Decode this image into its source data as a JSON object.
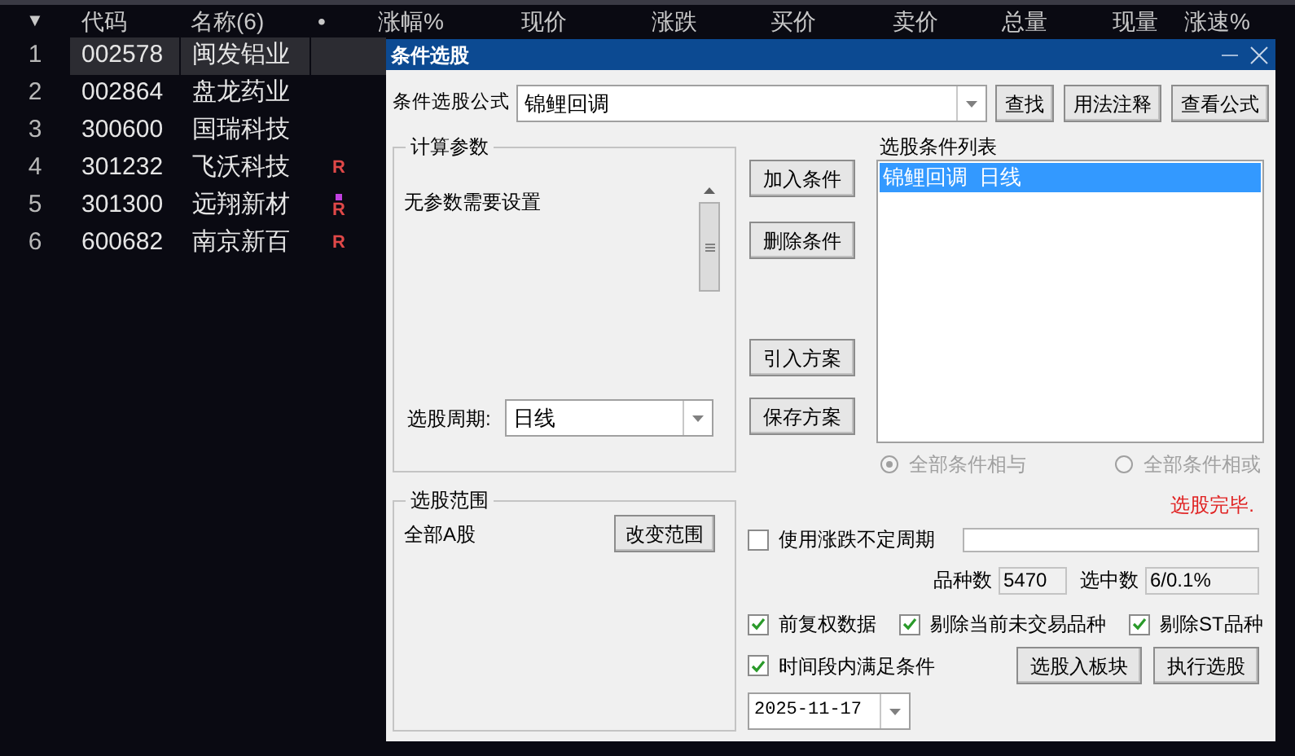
{
  "table": {
    "columns": [
      "▼",
      "代码",
      "名称(6)",
      "•",
      "涨幅%",
      "现价",
      "涨跌",
      "买价",
      "卖价",
      "总量",
      "现量",
      "涨速%"
    ],
    "rows": [
      {
        "index": "1",
        "code": "002578",
        "name": "闽发铝业",
        "selected": true,
        "marked": false
      },
      {
        "index": "2",
        "code": "002864",
        "name": "盘龙药业",
        "selected": false,
        "marked": false
      },
      {
        "index": "3",
        "code": "300600",
        "name": "国瑞科技",
        "selected": false,
        "marked": false
      },
      {
        "index": "4",
        "code": "301232",
        "name": "飞沃科技",
        "flag": "R",
        "selected": false,
        "marked": false
      },
      {
        "index": "5",
        "code": "301300",
        "name": "远翔新材",
        "flag": "R",
        "selected": false,
        "marked": true
      },
      {
        "index": "6",
        "code": "600682",
        "name": "南京新百",
        "flag": "R",
        "selected": false,
        "marked": false
      }
    ]
  },
  "dialog": {
    "title": "条件选股",
    "formula": {
      "label": "条件选股公式",
      "value": "锦鲤回调"
    },
    "top_buttons": [
      "查找",
      "用法注释",
      "查看公式"
    ],
    "params_group": {
      "title": "计算参数",
      "message": "无参数需要设置",
      "period_label": "选股周期:",
      "period_value": "日线"
    },
    "condition_buttons": [
      "加入条件",
      "删除条件"
    ],
    "plan_buttons": [
      "引入方案",
      "保存方案"
    ],
    "condition_list": {
      "label": "选股条件列表",
      "items": [
        {
          "text": "锦鲤回调  日线",
          "selected": true
        }
      ]
    },
    "logic_options": [
      {
        "label": "全部条件相与",
        "selected": true,
        "disabled": true
      },
      {
        "label": "全部条件相或",
        "selected": false,
        "disabled": true
      }
    ],
    "status": "选股完毕.",
    "range_group": {
      "title": "选股范围",
      "value": "全部A股",
      "button": "改变范围"
    },
    "variable_period": {
      "label": "使用涨跌不定周期",
      "checked": false
    },
    "counts": [
      {
        "label": "品种数",
        "value": "5470"
      },
      {
        "label": "选中数",
        "value": "6/0.1%"
      }
    ],
    "options": [
      {
        "label": "前复权数据",
        "checked": true
      },
      {
        "label": "剔除当前未交易品种",
        "checked": true
      },
      {
        "label": "剔除ST品种",
        "checked": true
      }
    ],
    "period_option": {
      "label": "时间段内满足条件",
      "checked": true
    },
    "action_buttons": [
      "选股入板块",
      "执行选股"
    ],
    "date": "2025-11-17"
  }
}
